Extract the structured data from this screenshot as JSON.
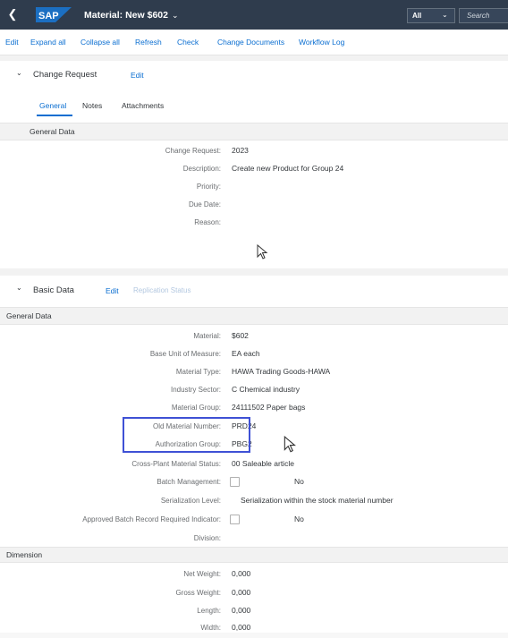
{
  "shell": {
    "brand": "SAP",
    "title": "Material: New $602",
    "scope": "All",
    "search_placeholder": "Search"
  },
  "toolbar": {
    "items": [
      "Edit",
      "Expand all",
      "Collapse all",
      "Refresh",
      "Check",
      "Change Documents",
      "Workflow Log"
    ]
  },
  "change_request": {
    "title": "Change Request",
    "edit": "Edit",
    "tabs": [
      "General",
      "Notes",
      "Attachments"
    ],
    "active_tab": "General",
    "group_title": "General Data",
    "fields": [
      {
        "label": "Change Request:",
        "value": "2023"
      },
      {
        "label": "Description:",
        "value": "Create new Product for Group 24"
      },
      {
        "label": "Priority:",
        "value": ""
      },
      {
        "label": "Due Date:",
        "value": ""
      },
      {
        "label": "Reason:",
        "value": ""
      }
    ]
  },
  "basic_data": {
    "title": "Basic Data",
    "edit": "Edit",
    "replication": "Replication Status",
    "group_title": "General Data",
    "fields": [
      {
        "label": "Material:",
        "value": "$602"
      },
      {
        "label": "Base Unit of Measure:",
        "value": "EA each"
      },
      {
        "label": "Material Type:",
        "value": "HAWA Trading Goods-HAWA"
      },
      {
        "label": "Industry Sector:",
        "value": "C Chemical industry"
      },
      {
        "label": "Material Group:",
        "value": "24111502 Paper bags"
      },
      {
        "label": "Old Material Number:",
        "value": "PRD24"
      },
      {
        "label": "Authorization Group:",
        "value": "PBG2"
      },
      {
        "label": "Cross-Plant Material Status:",
        "value": "00 Saleable article"
      },
      {
        "label": "Batch Management:",
        "value": "No"
      },
      {
        "label": "Serialization Level:",
        "value": "Serialization within the stock material number"
      },
      {
        "label": "Approved Batch Record Required Indicator:",
        "value": "No"
      },
      {
        "label": "Division:",
        "value": ""
      }
    ],
    "dimension_title": "Dimension",
    "dimension_fields": [
      {
        "label": "Net Weight:",
        "value": "0,000"
      },
      {
        "label": "Gross Weight:",
        "value": "0,000"
      },
      {
        "label": "Length:",
        "value": "0,000"
      },
      {
        "label": "Width:",
        "value": "0,000"
      }
    ]
  },
  "colors": {
    "shell_bg": "#2f3c4d",
    "link": "#0a6ed1",
    "highlight_box": "#3f51d5",
    "sap_logo": "#1b6fc2"
  }
}
